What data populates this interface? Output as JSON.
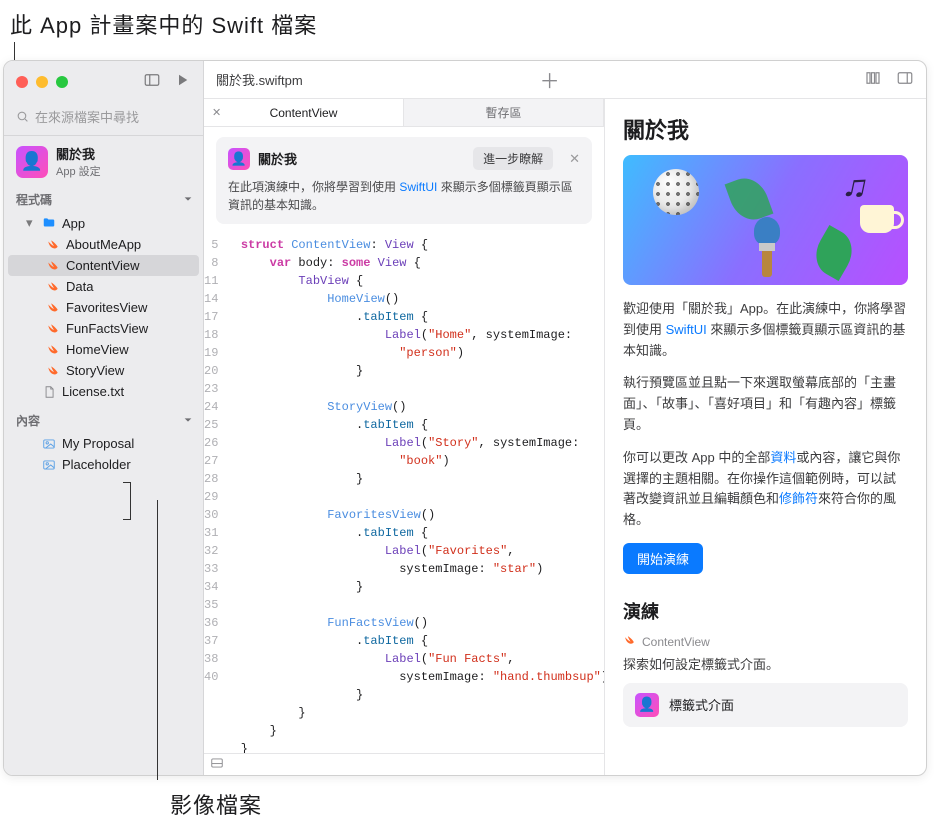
{
  "callouts": {
    "top": "此 App 計畫案中的 Swift 檔案",
    "bottom": "影像檔案"
  },
  "window": {
    "title": "關於我.swiftpm"
  },
  "sidebar": {
    "search_placeholder": "在來源檔案中尋找",
    "project": {
      "title": "關於我",
      "subtitle": "App 設定"
    },
    "sections": {
      "code": {
        "label": "程式碼",
        "folder": "App",
        "files": [
          "AboutMeApp",
          "ContentView",
          "Data",
          "FavoritesView",
          "FunFactsView",
          "HomeView",
          "StoryView"
        ],
        "license": "License.txt"
      },
      "content": {
        "label": "內容",
        "files": [
          "My Proposal",
          "Placeholder"
        ]
      }
    }
  },
  "tabs": {
    "active": "ContentView",
    "other": "暫存區"
  },
  "info_card": {
    "title": "關於我",
    "more": "進一步瞭解",
    "body_pre": "在此項演練中，你將學習到使用 ",
    "body_link": "SwiftUI",
    "body_post": " 來顯示多個標籤頁顯示區資訊的基本知識。"
  },
  "code": {
    "lines": [
      5,
      8,
      11,
      14,
      17,
      18,
      19,
      20,
      23,
      24,
      25,
      26,
      27,
      28,
      29,
      30,
      31,
      32,
      33,
      34,
      35,
      36,
      37,
      38,
      40
    ]
  },
  "preview": {
    "title": "關於我",
    "p1_pre": "歡迎使用「關於我」App。在此演練中，你將學習到使用 ",
    "p1_link": "SwiftUI",
    "p1_post": " 來顯示多個標籤頁顯示區資訊的基本知識。",
    "p2": "執行預覽區並且點一下來選取螢幕底部的「主畫面」、「故事」、「喜好項目」和「有趣內容」標籤頁。",
    "p3_pre": "你可以更改 App 中的全部",
    "p3_link1": "資料",
    "p3_mid": "或內容，讓它與你選擇的主題相關。在你操作這個範例時，可以試著改變資訊並且編輯顏色和",
    "p3_link2": "修飾符",
    "p3_post": "來符合你的風格。",
    "start_btn": "開始演練",
    "exercise": {
      "header": "演練",
      "file": "ContentView",
      "desc": "探索如何設定標籤式介面。",
      "card": "標籤式介面"
    }
  }
}
